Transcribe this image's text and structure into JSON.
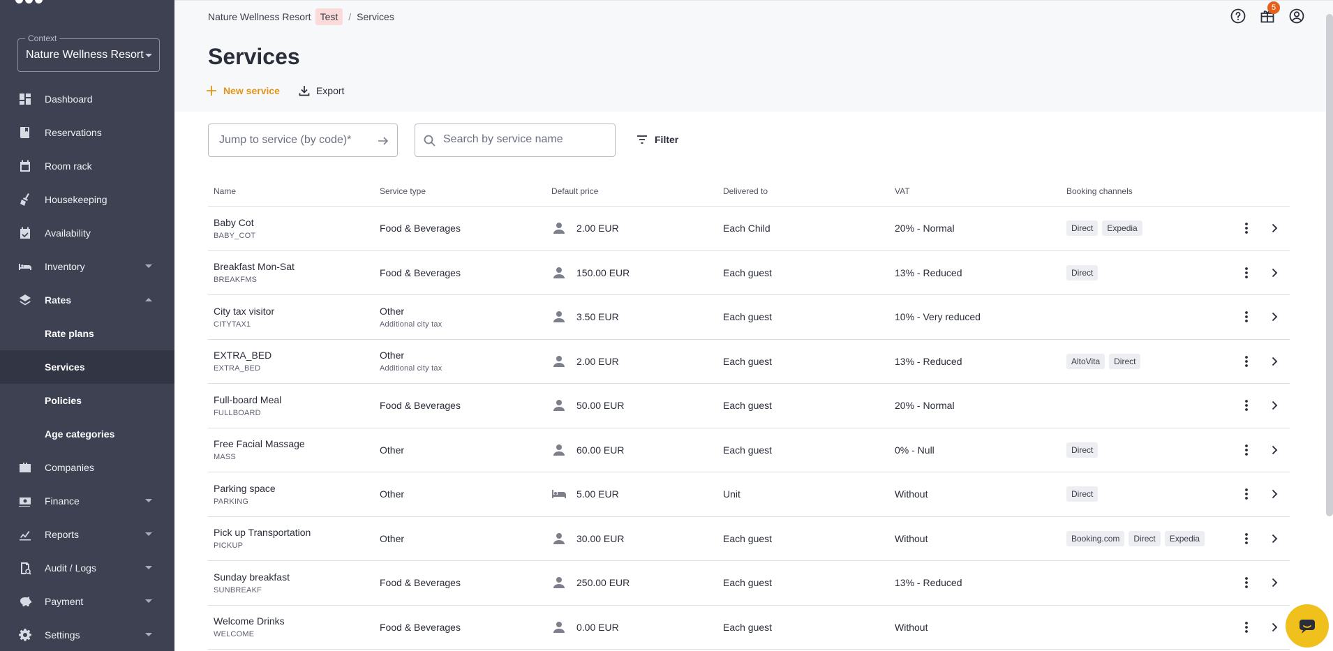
{
  "sidebar": {
    "context_legend": "Context",
    "context_value": "Nature Wellness Resort",
    "items": [
      {
        "label": "Dashboard",
        "icon": "dashboard-icon"
      },
      {
        "label": "Reservations",
        "icon": "book-icon"
      },
      {
        "label": "Room rack",
        "icon": "calendar-icon"
      },
      {
        "label": "Housekeeping",
        "icon": "broom-icon"
      },
      {
        "label": "Availability",
        "icon": "calendar-check-icon"
      },
      {
        "label": "Inventory",
        "icon": "bed-icon"
      },
      {
        "label": "Rates",
        "icon": "layers-icon"
      },
      {
        "label": "Companies",
        "icon": "briefcase-icon"
      },
      {
        "label": "Finance",
        "icon": "cash-icon"
      },
      {
        "label": "Reports",
        "icon": "chart-icon"
      },
      {
        "label": "Audit / Logs",
        "icon": "audit-icon"
      },
      {
        "label": "Payment",
        "icon": "piggy-bank-icon"
      },
      {
        "label": "Settings",
        "icon": "gear-icon"
      }
    ],
    "rates_sub": [
      "Rate plans",
      "Services",
      "Policies",
      "Age categories"
    ],
    "active_sub": "Services"
  },
  "breadcrumb": {
    "property": "Nature Wellness Resort",
    "env_badge": "Test",
    "separator": "/",
    "current": "Services"
  },
  "header": {
    "notifications_count": "5"
  },
  "page": {
    "title": "Services",
    "new_service_label": "New service",
    "export_label": "Export",
    "jump_placeholder": "Jump to service (by code)*",
    "search_placeholder": "Search by service name",
    "filter_label": "Filter"
  },
  "table": {
    "columns": [
      "Name",
      "Service type",
      "Default price",
      "Delivered to",
      "VAT",
      "Booking channels"
    ],
    "rows": [
      {
        "name": "Baby Cot",
        "code": "BABY_COT",
        "type": "Food & Beverages",
        "type_sub": "",
        "price_icon": "person-icon",
        "price": "2.00 EUR",
        "delivered": "Each Child",
        "vat": "20% - Normal",
        "channels": [
          "Direct",
          "Expedia"
        ]
      },
      {
        "name": "Breakfast Mon-Sat",
        "code": "BREAKFMS",
        "type": "Food & Beverages",
        "type_sub": "",
        "price_icon": "person-icon",
        "price": "150.00 EUR",
        "delivered": "Each guest",
        "vat": "13% - Reduced",
        "channels": [
          "Direct"
        ]
      },
      {
        "name": "City tax visitor",
        "code": "CITYTAX1",
        "type": "Other",
        "type_sub": "Additional city tax",
        "price_icon": "person-icon",
        "price": "3.50 EUR",
        "delivered": "Each guest",
        "vat": "10% - Very reduced",
        "channels": []
      },
      {
        "name": "EXTRA_BED",
        "code": "EXTRA_BED",
        "type": "Other",
        "type_sub": "Additional city tax",
        "price_icon": "person-icon",
        "price": "2.00 EUR",
        "delivered": "Each guest",
        "vat": "13% - Reduced",
        "channels": [
          "AltoVita",
          "Direct"
        ]
      },
      {
        "name": "Full-board Meal",
        "code": "FULLBOARD",
        "type": "Food & Beverages",
        "type_sub": "",
        "price_icon": "person-icon",
        "price": "50.00 EUR",
        "delivered": "Each guest",
        "vat": "20% - Normal",
        "channels": []
      },
      {
        "name": "Free Facial Massage",
        "code": "MASS",
        "type": "Other",
        "type_sub": "",
        "price_icon": "person-icon",
        "price": "60.00 EUR",
        "delivered": "Each guest",
        "vat": "0% - Null",
        "channels": [
          "Direct"
        ]
      },
      {
        "name": "Parking space",
        "code": "PARKING",
        "type": "Other",
        "type_sub": "",
        "price_icon": "bed-icon",
        "price": "5.00 EUR",
        "delivered": "Unit",
        "vat": "Without",
        "channels": [
          "Direct"
        ]
      },
      {
        "name": "Pick up Transportation",
        "code": "PICKUP",
        "type": "Other",
        "type_sub": "",
        "price_icon": "person-icon",
        "price": "30.00 EUR",
        "delivered": "Each guest",
        "vat": "Without",
        "channels": [
          "Booking.com",
          "Direct",
          "Expedia"
        ]
      },
      {
        "name": "Sunday breakfast",
        "code": "SUNBREAKF",
        "type": "Food & Beverages",
        "type_sub": "",
        "price_icon": "person-icon",
        "price": "250.00 EUR",
        "delivered": "Each guest",
        "vat": "13% - Reduced",
        "channels": []
      },
      {
        "name": "Welcome Drinks",
        "code": "WELCOME",
        "type": "Food & Beverages",
        "type_sub": "",
        "price_icon": "person-icon",
        "price": "0.00 EUR",
        "delivered": "Each guest",
        "vat": "Without",
        "channels": []
      }
    ]
  },
  "colors": {
    "sidebar_bg": "#3d4152",
    "accent": "#e0951a",
    "badge_bg": "#e5611b",
    "chat_button": "#f0c01c"
  }
}
